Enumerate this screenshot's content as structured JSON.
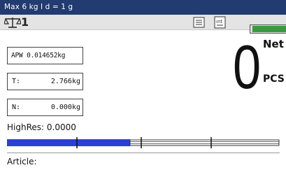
{
  "header": {
    "capacity_text": "Max 6 kg I d = 1 g"
  },
  "statusbar": {
    "scale_number": "1",
    "icons": [
      "scale-icon",
      "list-icon",
      "int-icon"
    ],
    "indicator_color": "#3a9a3a"
  },
  "fields": {
    "apw": "APW 0.014652kg",
    "tare_label": "T:",
    "tare_value": "2.766kg",
    "net_label": "N:",
    "net_value": "0.000kg"
  },
  "display": {
    "value": "0",
    "unit_top": "Net",
    "unit_bottom": "PCS"
  },
  "highres": "HighRes: 0.0000",
  "bargraph": {
    "fill_fraction": 0.45,
    "fill_color": "#2b3fd6"
  },
  "article": "Article:",
  "colors": {
    "topbar": "#223b71",
    "statusbar": "#e4e4e4"
  }
}
